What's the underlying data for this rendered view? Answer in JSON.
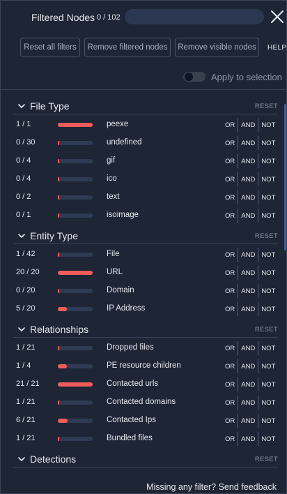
{
  "header": {
    "title": "Filtered Nodes",
    "count": "0 / 102",
    "search_placeholder": "",
    "close_icon": "close-icon"
  },
  "toolbar": {
    "reset_all": "Reset all filters",
    "remove_filtered": "Remove filtered nodes",
    "remove_visible": "Remove visible nodes",
    "help": "HELP"
  },
  "apply_toggle": {
    "label": "Apply to selection",
    "on": false
  },
  "ops": {
    "or": "OR",
    "and": "AND",
    "not": "NOT"
  },
  "colors": {
    "accent": "#f05b5b",
    "track": "#2f3b55",
    "background": "#1e2535"
  },
  "sections": [
    {
      "title": "File Type",
      "reset": "RESET",
      "rows": [
        {
          "frac": "1 / 1",
          "label": "peexe",
          "ratio": 1
        },
        {
          "frac": "0 / 30",
          "label": "undefined",
          "ratio": 0
        },
        {
          "frac": "0 / 4",
          "label": "gif",
          "ratio": 0
        },
        {
          "frac": "0 / 4",
          "label": "ico",
          "ratio": 0
        },
        {
          "frac": "0 / 2",
          "label": "text",
          "ratio": 0
        },
        {
          "frac": "0 / 1",
          "label": "isoimage",
          "ratio": 0
        }
      ]
    },
    {
      "title": "Entity Type",
      "reset": "RESET",
      "rows": [
        {
          "frac": "1 / 42",
          "label": "File",
          "ratio": 0.024
        },
        {
          "frac": "20 / 20",
          "label": "URL",
          "ratio": 1
        },
        {
          "frac": "0 / 20",
          "label": "Domain",
          "ratio": 0
        },
        {
          "frac": "5 / 20",
          "label": "IP Address",
          "ratio": 0.25
        }
      ]
    },
    {
      "title": "Relationships",
      "reset": "RESET",
      "rows": [
        {
          "frac": "1 / 21",
          "label": "Dropped files",
          "ratio": 0.048
        },
        {
          "frac": "1 / 4",
          "label": "PE resource children",
          "ratio": 0.25
        },
        {
          "frac": "21 / 21",
          "label": "Contacted urls",
          "ratio": 1
        },
        {
          "frac": "1 / 21",
          "label": "Contacted domains",
          "ratio": 0.048
        },
        {
          "frac": "6 / 21",
          "label": "Contacted Ips",
          "ratio": 0.286
        },
        {
          "frac": "1 / 21",
          "label": "Bundled files",
          "ratio": 0.048
        }
      ]
    },
    {
      "title": "Detections",
      "reset": "RESET",
      "rows": []
    }
  ],
  "feedback": "Missing any filter? Send feedback"
}
